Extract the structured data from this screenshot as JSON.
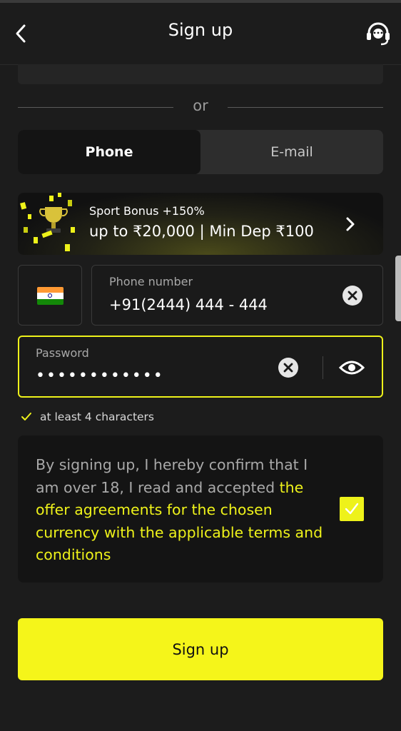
{
  "header": {
    "title": "Sign up",
    "back_icon": "chevron-left-icon",
    "support_icon": "headset-icon"
  },
  "divider": {
    "text": "or"
  },
  "tabs": [
    {
      "label": "Phone",
      "active": true
    },
    {
      "label": "E-mail",
      "active": false
    }
  ],
  "banner": {
    "title": "Sport Bonus +150%",
    "subtitle": "up to ₹20,000 | Min Dep ₹100",
    "icon": "trophy-icon"
  },
  "phone": {
    "country_flag": "india-flag-icon",
    "label": "Phone number",
    "value": "+91(2444) 444 - 444"
  },
  "password": {
    "label": "Password",
    "value": "••••••••••••",
    "visibility_icon": "eye-icon"
  },
  "hint": {
    "text": "at least 4 characters",
    "status": "satisfied"
  },
  "terms": {
    "text_plain": "By signing up, I hereby confirm that I am over 18, I read and accepted ",
    "text_link": "the offer agreements for the chosen currency with the applicable terms and conditions",
    "checked": true
  },
  "signup_button": {
    "label": "Sign up"
  },
  "colors": {
    "accent": "#eef21a",
    "background": "#1c1c1c",
    "field": "#1a1a1a"
  }
}
